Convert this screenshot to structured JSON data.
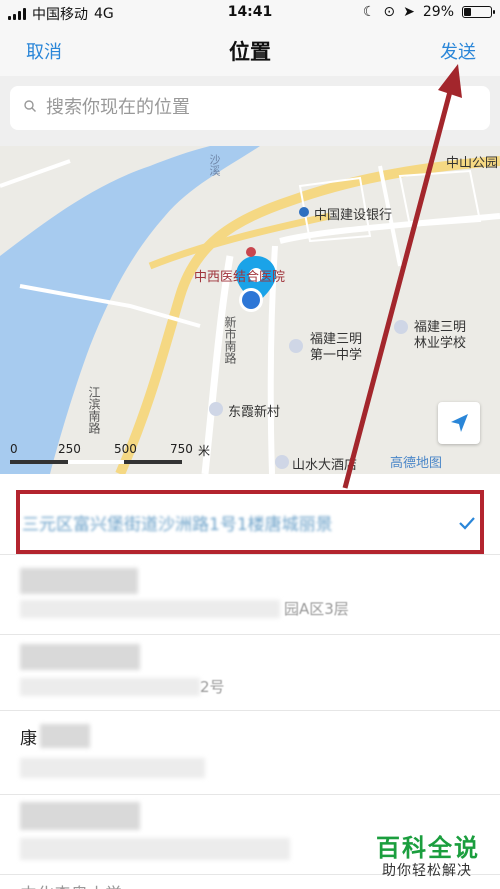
{
  "status_bar": {
    "carrier": "中国移动",
    "network": "4G",
    "time": "14:41",
    "battery_text": "29%",
    "battery_level": 0.29
  },
  "nav": {
    "cancel": "取消",
    "title": "位置",
    "send": "发送"
  },
  "search": {
    "placeholder": "搜索你现在的位置"
  },
  "map": {
    "labels": {
      "bank": "中国建设银行",
      "hospital": "中西医结合医院",
      "school1": "福建三明\n第一中学",
      "school2": "福建三明\n林业学校",
      "village": "东霞新村",
      "hotel": "山水大酒店",
      "park": "中山公园",
      "road1": "新市南路",
      "road2": "江滨南路",
      "river": "沙溪",
      "provider": "高德地图"
    },
    "scale": {
      "ticks": [
        "0",
        "250",
        "500",
        "750"
      ],
      "unit": "米"
    }
  },
  "list": {
    "selected_address": "三元区富兴堡街道沙洲路1号1楼唐城丽景",
    "row2_sub": "园A区3层",
    "row3_sub": "2号",
    "row4_name": "康",
    "row6_name": "中化森奥小学"
  },
  "watermark": {
    "title": "百科全说",
    "subtitle": "助你轻松解决"
  },
  "colors": {
    "accent": "#2a86d8",
    "highlight_box": "#b3242e",
    "arrow": "#a3262c",
    "brand": "#1b9e3e"
  }
}
